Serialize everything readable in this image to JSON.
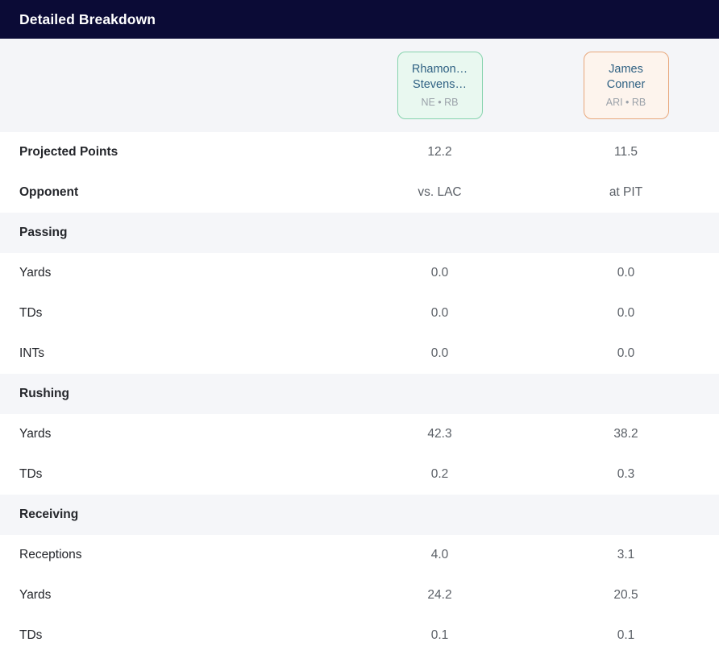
{
  "header": {
    "title": "Detailed Breakdown"
  },
  "columns": [
    {
      "name": "Rhamon…",
      "name_line2": "Stevens…",
      "meta": "NE • RB",
      "accent": "#86d3ad",
      "background": "#e9f8f0"
    },
    {
      "name": "James",
      "name_line2": "Conner",
      "meta": "ARI • RB",
      "accent": "#e8a87c",
      "background": "#fdf4ed"
    }
  ],
  "rows": [
    {
      "type": "stat",
      "emphasis": true,
      "label": "Projected Points",
      "values": [
        "12.2",
        "11.5"
      ]
    },
    {
      "type": "stat",
      "emphasis": true,
      "label": "Opponent",
      "values": [
        "vs. LAC",
        "at PIT"
      ]
    },
    {
      "type": "section",
      "label": "Passing"
    },
    {
      "type": "stat",
      "emphasis": false,
      "label": "Yards",
      "values": [
        "0.0",
        "0.0"
      ]
    },
    {
      "type": "stat",
      "emphasis": false,
      "label": "TDs",
      "values": [
        "0.0",
        "0.0"
      ]
    },
    {
      "type": "stat",
      "emphasis": false,
      "label": "INTs",
      "values": [
        "0.0",
        "0.0"
      ]
    },
    {
      "type": "section",
      "label": "Rushing"
    },
    {
      "type": "stat",
      "emphasis": false,
      "label": "Yards",
      "values": [
        "42.3",
        "38.2"
      ]
    },
    {
      "type": "stat",
      "emphasis": false,
      "label": "TDs",
      "values": [
        "0.2",
        "0.3"
      ]
    },
    {
      "type": "section",
      "label": "Receiving"
    },
    {
      "type": "stat",
      "emphasis": false,
      "label": "Receptions",
      "values": [
        "4.0",
        "3.1"
      ]
    },
    {
      "type": "stat",
      "emphasis": false,
      "label": "Yards",
      "values": [
        "24.2",
        "20.5"
      ]
    },
    {
      "type": "stat",
      "emphasis": false,
      "label": "TDs",
      "values": [
        "0.1",
        "0.1"
      ]
    }
  ],
  "theme": {
    "titlebar_background": "#0b0b36",
    "section_background": "#f5f6f9",
    "header_background": "#f4f5f8"
  }
}
